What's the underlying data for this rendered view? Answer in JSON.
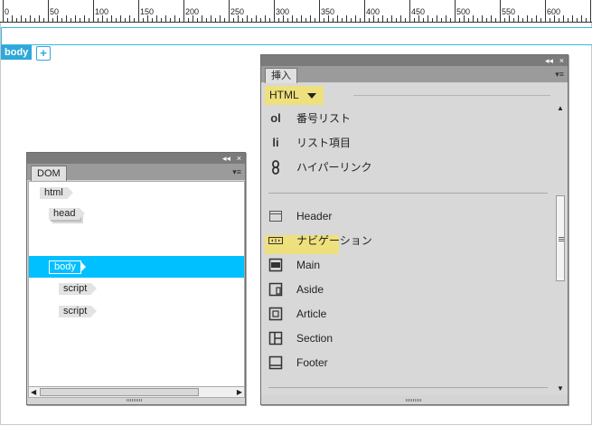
{
  "ruler": {
    "labels": [
      "0",
      "50",
      "100",
      "150",
      "200",
      "250",
      "300",
      "350",
      "400",
      "450",
      "500",
      "550",
      "600"
    ]
  },
  "canvas": {
    "body_tag": "body",
    "add_button": "+"
  },
  "dom_panel": {
    "tab": "DOM",
    "collapse_glyph": "◂◂",
    "close_glyph": "×",
    "menu_glyph": "▾≡",
    "nodes": [
      "html",
      "head",
      "body",
      "script",
      "script"
    ]
  },
  "insert_panel": {
    "tab": "挿入",
    "collapse_glyph": "◂◂",
    "close_glyph": "×",
    "menu_glyph": "▾≡",
    "category": "HTML",
    "items": [
      {
        "icon": "ol",
        "label": "番号リスト"
      },
      {
        "icon": "li",
        "label": "リスト項目"
      },
      {
        "icon": "link-icon",
        "label": "ハイパーリンク"
      },
      {
        "icon": "header-icon",
        "label": "Header"
      },
      {
        "icon": "nav-icon",
        "label": "ナビゲーション"
      },
      {
        "icon": "main-icon",
        "label": "Main"
      },
      {
        "icon": "aside-icon",
        "label": "Aside"
      },
      {
        "icon": "article-icon",
        "label": "Article"
      },
      {
        "icon": "section-icon",
        "label": "Section"
      },
      {
        "icon": "footer-icon",
        "label": "Footer"
      }
    ]
  },
  "colors": {
    "highlight": "#eee07c",
    "selection": "#00c0ff",
    "body_tag": "#2ea8db"
  }
}
